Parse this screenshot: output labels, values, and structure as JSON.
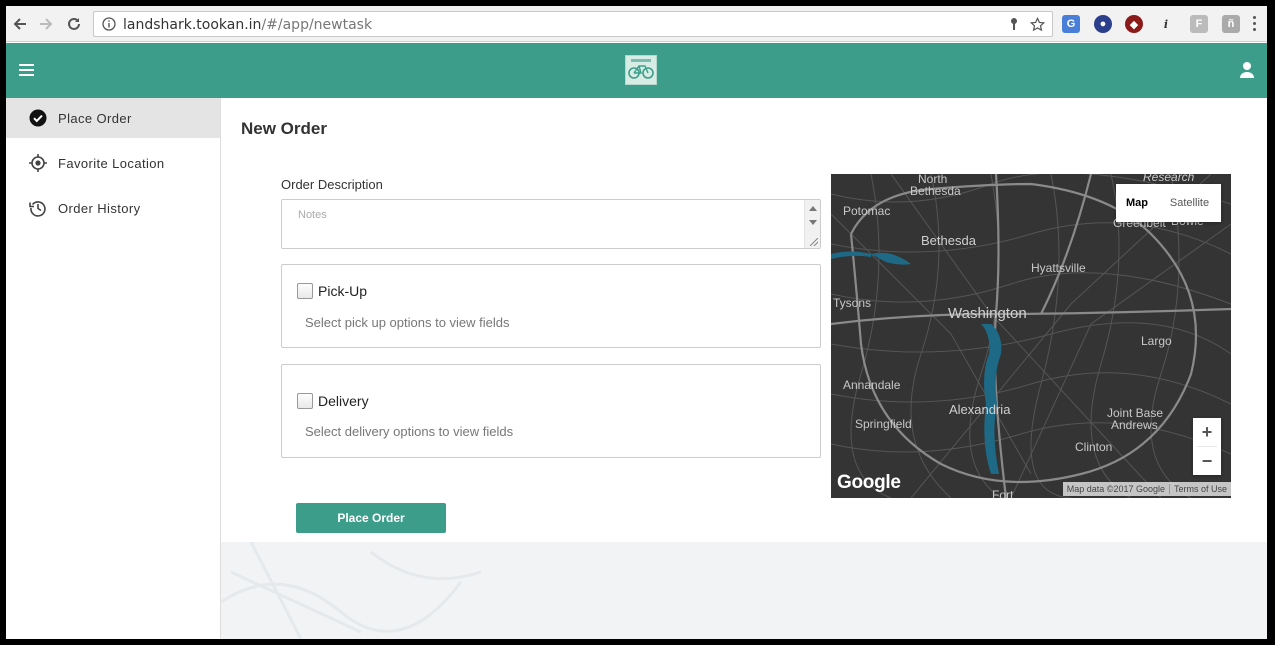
{
  "browser": {
    "url_host": "landshark.tookan.in",
    "url_path": "/#/app/newtask"
  },
  "header": {
    "menu_icon": "hamburger-icon",
    "logo_icon": "bicycle-logo",
    "user_icon": "user-icon"
  },
  "sidebar": {
    "items": [
      {
        "label": "Place Order",
        "icon": "check-circle-icon",
        "active": true
      },
      {
        "label": "Favorite Location",
        "icon": "crosshair-icon",
        "active": false
      },
      {
        "label": "Order History",
        "icon": "history-icon",
        "active": false
      }
    ]
  },
  "main": {
    "title": "New Order",
    "description_label": "Order Description",
    "notes_placeholder": "Notes",
    "pickup": {
      "label": "Pick-Up",
      "hint": "Select pick up options to view fields"
    },
    "delivery": {
      "label": "Delivery",
      "hint": "Select delivery options to view fields"
    },
    "place_order_label": "Place Order"
  },
  "map": {
    "type_map": "Map",
    "type_satellite": "Satellite",
    "zoom_in": "+",
    "zoom_out": "−",
    "google": "Google",
    "map_data": "Map data ©2017 Google",
    "terms": "Terms of Use",
    "labels": {
      "washington": "Washington",
      "bethesda": "Bethesda",
      "north_bethesda_1": "North",
      "north_bethesda_2": "Bethesda",
      "potomac": "Potomac",
      "hyattsville": "Hyattsville",
      "greenbelt": "Greenbelt",
      "bowie": "Bowie",
      "research": "Research",
      "tysons": "Tysons",
      "largo": "Largo",
      "annandale": "Annandale",
      "alexandria": "Alexandria",
      "springfield": "Springfield",
      "joint_base_1": "Joint Base",
      "joint_base_2": "Andrews",
      "clinton": "Clinton",
      "fort": "Fort"
    }
  },
  "colors": {
    "brand": "#3c9e8a",
    "map_bg": "#343434",
    "water": "#1e6a86"
  }
}
